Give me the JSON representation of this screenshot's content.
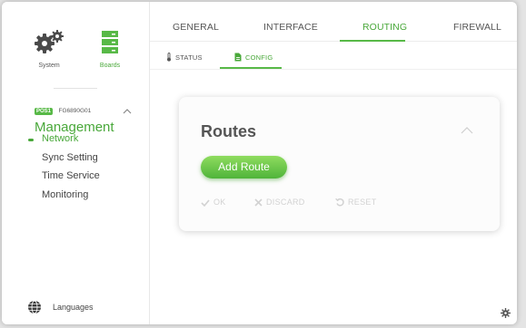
{
  "sidebar": {
    "system_label": "System",
    "boards_label": "Boards",
    "device": {
      "badge": "POS1",
      "model": "FG6890G01",
      "title": "Management"
    },
    "nav": [
      {
        "label": "Network",
        "active": true
      },
      {
        "label": "Sync Setting",
        "active": false
      },
      {
        "label": "Time Service",
        "active": false
      },
      {
        "label": "Monitoring",
        "active": false
      }
    ],
    "languages_label": "Languages"
  },
  "tabs": [
    {
      "label": "GENERAL",
      "active": false
    },
    {
      "label": "INTERFACE",
      "active": false
    },
    {
      "label": "ROUTING",
      "active": true
    },
    {
      "label": "FIREWALL",
      "active": false
    }
  ],
  "subtabs": [
    {
      "label": "STATUS",
      "icon": "thermometer-icon",
      "active": false
    },
    {
      "label": "CONFIG",
      "icon": "document-icon",
      "active": true
    }
  ],
  "card": {
    "title": "Routes",
    "add_button": "Add Route",
    "actions": {
      "ok": "OK",
      "discard": "DISCARD",
      "reset": "RESET"
    }
  },
  "colors": {
    "accent": "#49a83a",
    "disabled": "#d2d2d2"
  }
}
